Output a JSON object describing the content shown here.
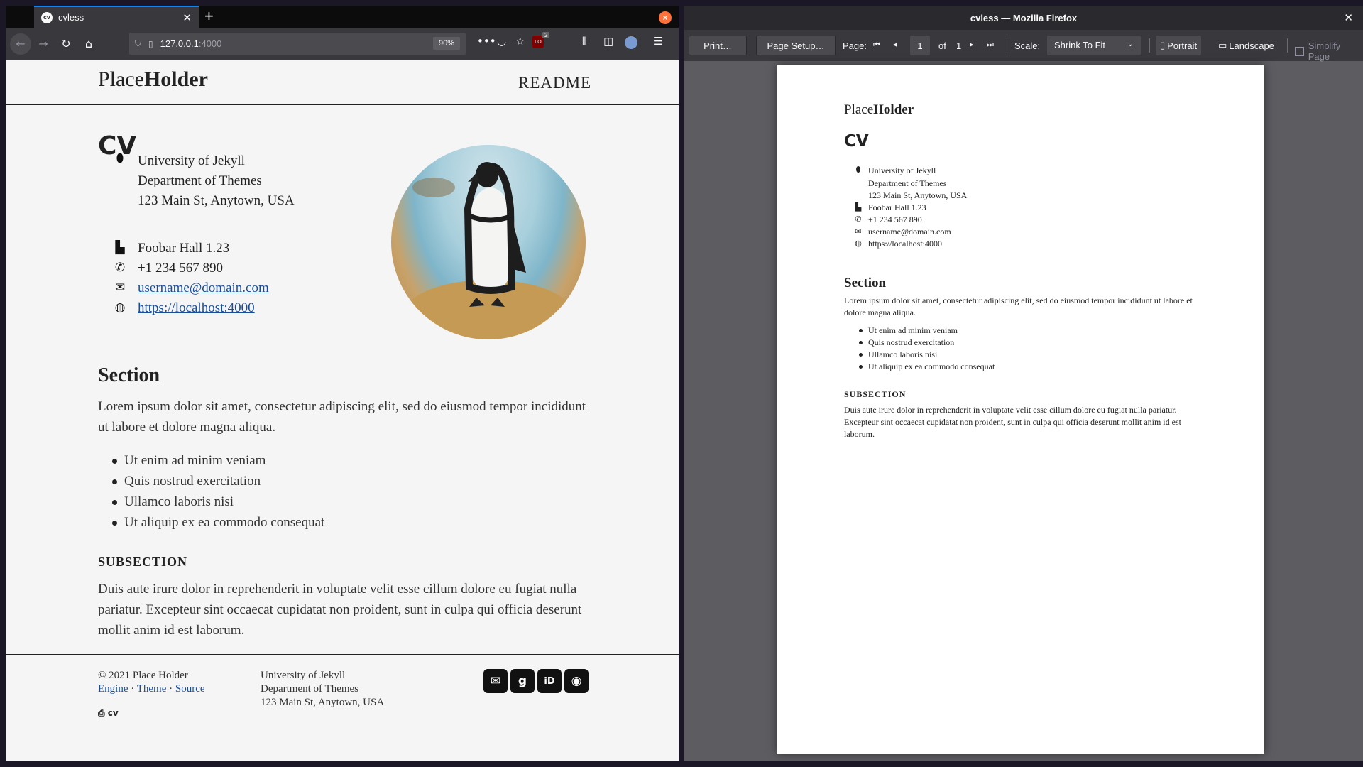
{
  "browser": {
    "tab_title": "cvless",
    "tab_favicon_text": "cv",
    "url_host": "127.0.0.1",
    "url_port": ":4000",
    "zoom": "90%",
    "ublock_count": "2"
  },
  "site": {
    "logo_place": "Place",
    "logo_holder": "Holder",
    "nav_readme": "README",
    "cv_title": "CV",
    "address_line1": "University of Jekyll",
    "address_line2": "Department of Themes",
    "address_line3": "123 Main St, Anytown, USA",
    "office": "Foobar Hall 1.23",
    "phone": "+1 234 567 890",
    "email": "username@domain.com",
    "website": "https://localhost:4000",
    "section_title": "Section",
    "section_para": "Lorem ipsum dolor sit amet, consectetur adipiscing elit, sed do eiusmod tempor incididunt ut labore et dolore magna aliqua.",
    "list_items": [
      "Ut enim ad minim veniam",
      "Quis nostrud exercitation",
      "Ullamco laboris nisi",
      "Ut aliquip ex ea commodo consequat"
    ],
    "subsection_title": "SUBSECTION",
    "subsection_para": "Duis aute irure dolor in reprehenderit in voluptate velit esse cillum dolore eu fugiat nulla pariatur. Excepteur sint occaecat cupidatat non proident, sunt in culpa qui officia deserunt mollit anim id est laborum."
  },
  "footer": {
    "copyright": "© 2021 Place Holder",
    "link_engine": "Engine",
    "link_theme": "Theme",
    "link_source": "Source",
    "sep": " · ",
    "addr1": "University of Jekyll",
    "addr2": "Department of Themes",
    "addr3": "123 Main St, Anytown, USA",
    "print_label": "cv",
    "social_icons": [
      "envelope-icon",
      "google-scholar-icon",
      "orcid-icon",
      "github-icon"
    ]
  },
  "print_preview": {
    "window_title": "cvless — Mozilla Firefox",
    "print_btn": "Print…",
    "page_setup_btn": "Page Setup…",
    "page_label": "Page:",
    "page_current": "1",
    "page_of": "of",
    "page_total": "1",
    "scale_label": "Scale:",
    "scale_value": "Shrink To Fit",
    "portrait": "Portrait",
    "landscape": "Landscape",
    "simplify": "Simplify Page"
  },
  "colors": {
    "link": "#1a4d99",
    "accent_tab": "#0a84ff",
    "firefox_orange": "#ff7139"
  }
}
